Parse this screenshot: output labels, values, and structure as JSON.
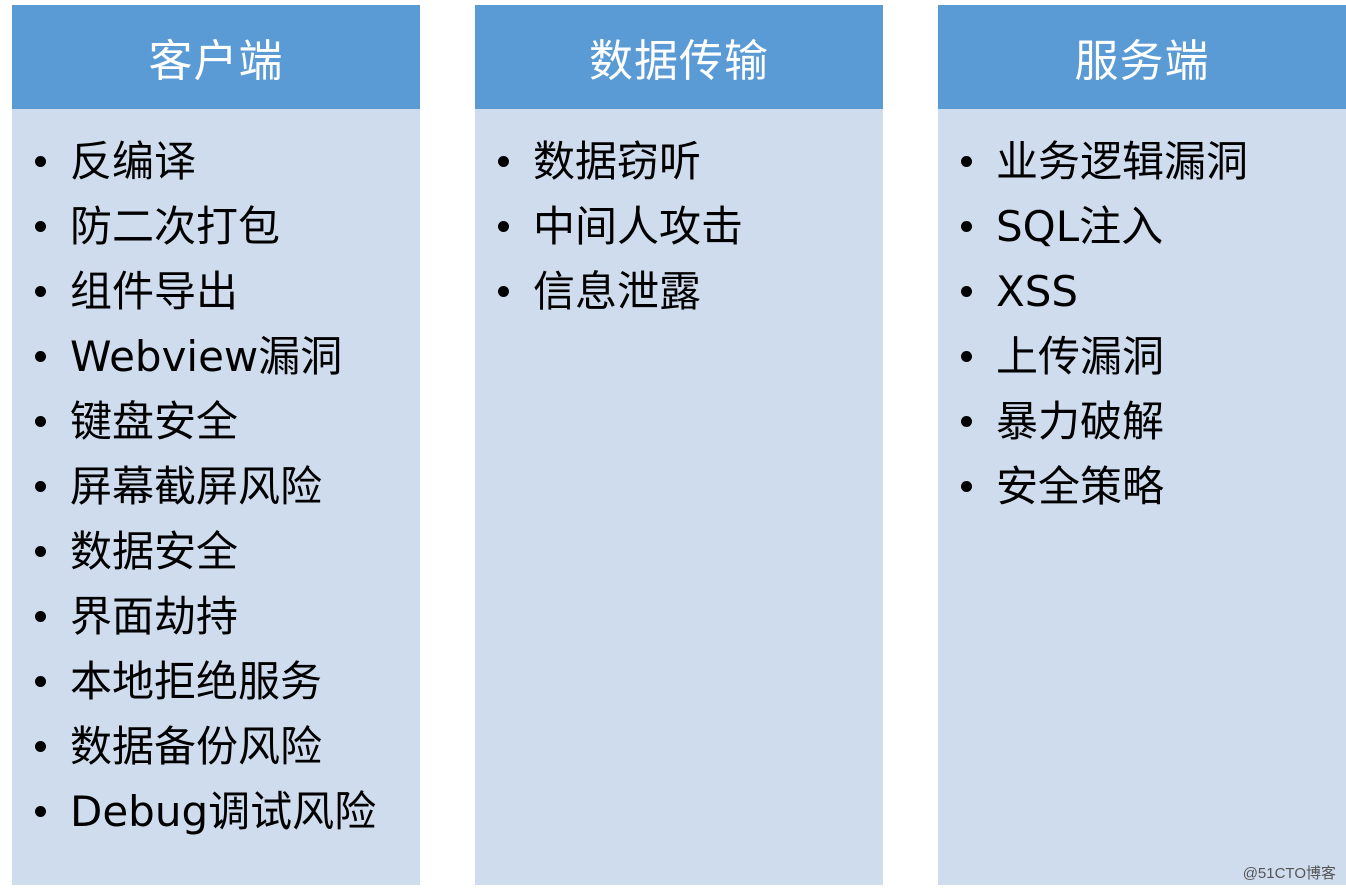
{
  "columns": [
    {
      "title": "客户端",
      "items": [
        "反编译",
        "防二次打包",
        "组件导出",
        "Webview漏洞",
        "键盘安全",
        "屏幕截屏风险",
        "数据安全",
        "界面劫持",
        "本地拒绝服务",
        "数据备份风险",
        "Debug调试风险"
      ]
    },
    {
      "title": "数据传输",
      "items": [
        "数据窃听",
        "中间人攻击",
        "信息泄露"
      ]
    },
    {
      "title": "服务端",
      "items": [
        "业务逻辑漏洞",
        "SQL注入",
        "XSS",
        "上传漏洞",
        "暴力破解",
        "安全策略"
      ]
    }
  ],
  "watermark": "@51CTO博客",
  "colors": {
    "header_bg": "#5b9bd5",
    "body_bg": "#cfdcee",
    "header_text": "#ffffff",
    "item_text": "#000000"
  }
}
